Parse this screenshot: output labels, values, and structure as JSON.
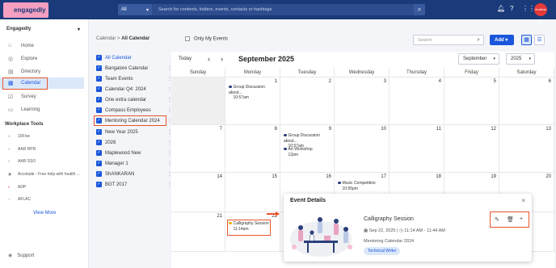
{
  "topbar": {
    "logo_text": "engagedly",
    "search_scope": "All",
    "search_placeholder": "Search for contents, folders, events, contacts or hashtags",
    "avatar_text": "Jonathan Dee"
  },
  "sidebar": {
    "org_name": "Engagedly",
    "nav": [
      {
        "label": "Home",
        "icon": "home-icon"
      },
      {
        "label": "Explore",
        "icon": "compass-icon"
      },
      {
        "label": "Directory",
        "icon": "directory-icon"
      },
      {
        "label": "Calendar",
        "icon": "calendar-icon"
      },
      {
        "label": "Survey",
        "icon": "survey-icon"
      },
      {
        "label": "Learning",
        "icon": "learning-icon"
      }
    ],
    "workplace_tools_title": "Workplace Tools",
    "tools": [
      {
        "label": "15Five",
        "icon": "15five-logo"
      },
      {
        "label": "AAR RPR",
        "icon": "aar-logo"
      },
      {
        "label": "AAR SSO",
        "icon": "aar-logo"
      },
      {
        "label": "Accolade - Free help with health ...",
        "icon": "accolade-logo"
      },
      {
        "label": "ADP",
        "icon": "adp-logo"
      },
      {
        "label": "AFLAC",
        "icon": "aflac-logo"
      }
    ],
    "view_more": "View More",
    "support": "Support"
  },
  "header": {
    "breadcrumb_parent": "Calendar",
    "breadcrumb_sep": ">",
    "breadcrumb_current": "All Calendar",
    "only_my_events": "Only My Events",
    "search_placeholder": "Search",
    "add_button": "Add ▾"
  },
  "calendars": [
    {
      "name": "All Calendar"
    },
    {
      "name": "Bangalore Calendar"
    },
    {
      "name": "Team Events"
    },
    {
      "name": "Calendar Q4: 2024"
    },
    {
      "name": "One extra calendar"
    },
    {
      "name": "Compass Employees"
    },
    {
      "name": "Mentoring Calendar 2024"
    },
    {
      "name": "New Year 2025"
    },
    {
      "name": "2026"
    },
    {
      "name": "Maplewood New"
    },
    {
      "name": "Manager 1"
    },
    {
      "name": "ShANKARAN"
    },
    {
      "name": "BGT 2017"
    }
  ],
  "calendar": {
    "today_label": "Today",
    "prev_arrow": "‹",
    "next_arrow": "›",
    "month_title": "September 2025",
    "month_select": "September",
    "year_select": "2025",
    "days_of_week": [
      "Sunday",
      "Monday",
      "Tuesday",
      "Wednesday",
      "Thursday",
      "Friday",
      "Saturday"
    ],
    "rows": [
      [
        "",
        "1",
        "2",
        "3",
        "4",
        "5",
        "6"
      ],
      [
        "7",
        "8",
        "9",
        "10",
        "11",
        "12",
        "13"
      ],
      [
        "14",
        "15",
        "16",
        "17",
        "18",
        "19",
        "20"
      ],
      [
        "21",
        "22",
        "23",
        "",
        "",
        "",
        ""
      ]
    ],
    "events": {
      "e1_title": "Group Discussion about...",
      "e1_time": "10:57am",
      "e2_title": "Group Discussion about...",
      "e2_time": "10:57am",
      "e3_title": "Art Workshop",
      "e3_time": "12pm",
      "e4_title": "Music Competition",
      "e4_time": "10:55pm",
      "e5_title": "Calligraphy Session",
      "e5_time": "11:14am"
    }
  },
  "event_details": {
    "title": "Event Details",
    "close": "×",
    "event_name": "Calligraphy Session",
    "date_time": "Sep 22, 2025 | ◷ 11:14 AM - 11:44 AM",
    "calendar_name": "Mentoring Calendar 2024",
    "tag": "Technical Writer"
  },
  "colors": {
    "topbar": "#1a3a7a",
    "accent": "#1a56db",
    "highlight": "#e8542a"
  }
}
